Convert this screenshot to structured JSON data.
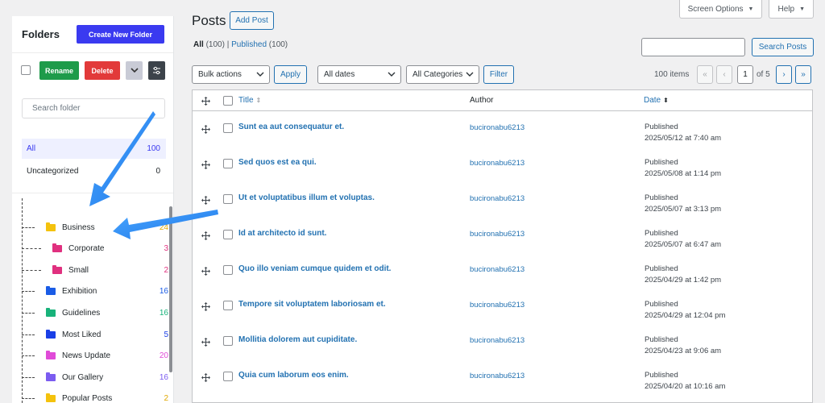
{
  "folders_panel": {
    "title": "Folders",
    "create_button": "Create New Folder",
    "rename_button": "Rename",
    "delete_button": "Delete",
    "search_placeholder": "Search folder",
    "all": {
      "label": "All",
      "count": "100"
    },
    "uncategorized": {
      "label": "Uncategorized",
      "count": "0"
    },
    "tree": [
      {
        "name": "Business",
        "count": "24",
        "color": "#f4c20d",
        "count_color": "#e0a800",
        "level": 0
      },
      {
        "name": "Corporate",
        "count": "3",
        "color": "#e0307f",
        "count_color": "#e0307f",
        "level": 1
      },
      {
        "name": "Small",
        "count": "2",
        "color": "#e0307f",
        "count_color": "#e0307f",
        "level": 1
      },
      {
        "name": "Exhibition",
        "count": "16",
        "color": "#1a5ce6",
        "count_color": "#1a5ce6",
        "level": 0
      },
      {
        "name": "Guidelines",
        "count": "16",
        "color": "#18b27a",
        "count_color": "#18b27a",
        "level": 0
      },
      {
        "name": "Most Liked",
        "count": "5",
        "color": "#1a3fe6",
        "count_color": "#1a3fe6",
        "level": 0
      },
      {
        "name": "News Update",
        "count": "20",
        "color": "#e04bd8",
        "count_color": "#e04bd8",
        "level": 0
      },
      {
        "name": "Our Gallery",
        "count": "16",
        "color": "#7b5cf0",
        "count_color": "#7b5cf0",
        "level": 0
      },
      {
        "name": "Popular Posts",
        "count": "2",
        "color": "#f4c20d",
        "count_color": "#e0a800",
        "level": 0
      }
    ]
  },
  "header": {
    "page_title": "Posts",
    "add_button": "Add Post",
    "screen_options": "Screen Options",
    "help": "Help"
  },
  "filters": {
    "all_label": "All",
    "all_count": "(100)",
    "separator": "|",
    "published_label": "Published",
    "published_count": "(100)",
    "search_button": "Search Posts",
    "bulk_actions": "Bulk actions",
    "apply": "Apply",
    "dates": "All dates",
    "categories": "All Categories",
    "filter": "Filter"
  },
  "pagination": {
    "items": "100 items",
    "first": "«",
    "prev": "‹",
    "current": "1",
    "of": "of 5",
    "next": "›",
    "last": "»"
  },
  "table": {
    "columns": {
      "title": "Title",
      "author": "Author",
      "date": "Date"
    },
    "rows": [
      {
        "title": "Sunt ea aut consequatur et.",
        "author": "bucironabu6213",
        "status": "Published",
        "date": "2025/05/12 at 7:40 am"
      },
      {
        "title": "Sed quos est ea qui.",
        "author": "bucironabu6213",
        "status": "Published",
        "date": "2025/05/08 at 1:14 pm"
      },
      {
        "title": "Ut et voluptatibus illum et voluptas.",
        "author": "bucironabu6213",
        "status": "Published",
        "date": "2025/05/07 at 3:13 pm"
      },
      {
        "title": "Id at architecto id sunt.",
        "author": "bucironabu6213",
        "status": "Published",
        "date": "2025/05/07 at 6:47 am"
      },
      {
        "title": "Quo illo veniam cumque quidem et odit.",
        "author": "bucironabu6213",
        "status": "Published",
        "date": "2025/04/29 at 1:42 pm"
      },
      {
        "title": "Tempore sit voluptatem laboriosam et.",
        "author": "bucironabu6213",
        "status": "Published",
        "date": "2025/04/29 at 12:04 pm"
      },
      {
        "title": "Mollitia dolorem aut cupiditate.",
        "author": "bucironabu6213",
        "status": "Published",
        "date": "2025/04/23 at 9:06 am"
      },
      {
        "title": "Quia cum laborum eos enim.",
        "author": "bucironabu6213",
        "status": "Published",
        "date": "2025/04/20 at 10:16 am"
      }
    ]
  },
  "colors": {
    "accent": "#2271b1",
    "annotation_arrow": "#1e8cf0",
    "create_button": "#3a3af0",
    "rename_button": "#1e9b4a",
    "delete_button": "#e23a3a"
  }
}
